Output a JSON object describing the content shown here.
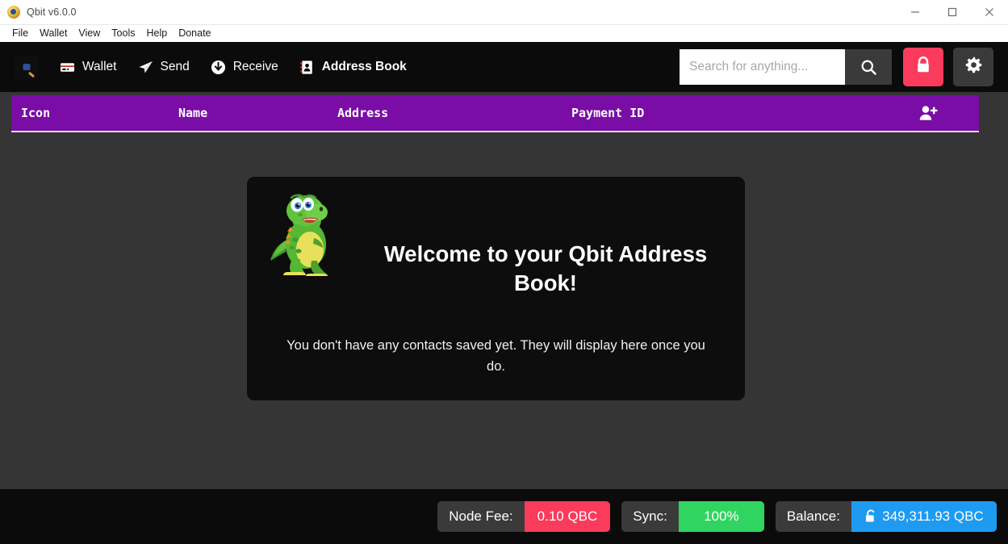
{
  "window": {
    "title": "Qbit v6.0.0",
    "controls": {
      "minimize": "minimize",
      "maximize": "maximize",
      "close": "close"
    }
  },
  "menubar": {
    "items": [
      {
        "label": "File"
      },
      {
        "label": "Wallet"
      },
      {
        "label": "View"
      },
      {
        "label": "Tools"
      },
      {
        "label": "Help"
      },
      {
        "label": "Donate"
      }
    ]
  },
  "toolbar": {
    "nav": [
      {
        "label": "Wallet",
        "icon": "wallet-icon",
        "active": false
      },
      {
        "label": "Send",
        "icon": "send-icon",
        "active": false
      },
      {
        "label": "Receive",
        "icon": "receive-icon",
        "active": false
      },
      {
        "label": "Address Book",
        "icon": "address-book-icon",
        "active": true
      }
    ],
    "search": {
      "placeholder": "Search for anything...",
      "value": ""
    },
    "search_button": "search-icon",
    "lock_button": "lock-icon",
    "settings_button": "gear-icon"
  },
  "table": {
    "columns": [
      {
        "label": "Icon"
      },
      {
        "label": "Name"
      },
      {
        "label": "Address"
      },
      {
        "label": "Payment ID"
      }
    ],
    "add_contact": "add-contact-icon"
  },
  "welcome": {
    "title": "Welcome to your Qbit Address Book!",
    "subtitle": "You don't have any contacts saved yet. They will display here once you do.",
    "mascot": "dinosaur-mascot"
  },
  "statusbar": {
    "node_fee": {
      "label": "Node Fee:",
      "value": "0.10 QBC"
    },
    "sync": {
      "label": "Sync:",
      "value": "100%"
    },
    "balance": {
      "label": "Balance:",
      "value": "349,311.93 QBC",
      "icon": "unlocked-padlock-icon"
    }
  },
  "colors": {
    "accent_purple": "#7a0da5",
    "pink": "#fb3b5c",
    "green": "#2fd560",
    "blue": "#1e9bf0",
    "toolbar_bg": "#0b0b0b",
    "content_bg": "#353535",
    "card_bg": "#0d0d0d"
  }
}
